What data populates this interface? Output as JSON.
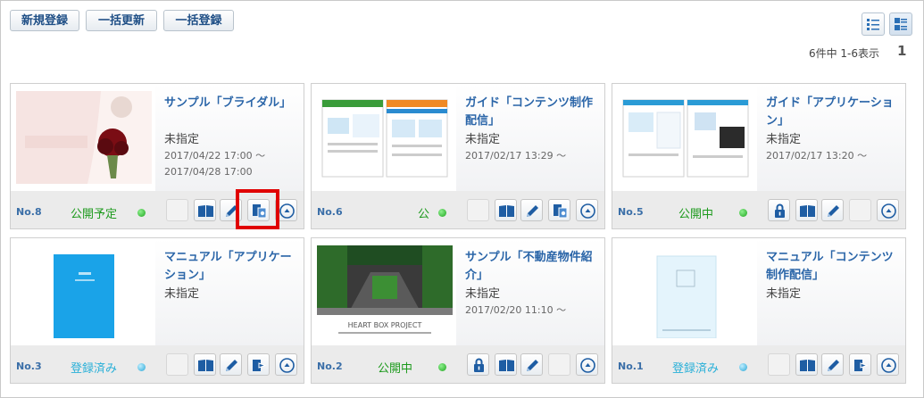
{
  "toolbar": {
    "new_label": "新規登録",
    "bulk_update_label": "一括更新",
    "bulk_register_label": "一括登録"
  },
  "view": {
    "list_icon": "list-view-icon",
    "card_icon": "card-view-icon",
    "active": "card"
  },
  "pagination": {
    "summary": "6件中 1-6表示",
    "page": "1"
  },
  "colors": {
    "published": "#1d9a1d",
    "registered": "#2ab0d8",
    "title": "#2a65a8",
    "highlight": "#e00000"
  },
  "cards": [
    {
      "title": "サンプル「ブライダル」",
      "category": "未指定",
      "date1": "2017/04/22 17:00 ～",
      "date2": "2017/04/28 17:00",
      "no": "No.8",
      "status": "公開予定",
      "status_color": "green"
    },
    {
      "title": "ガイド「コンテンツ制作配信」",
      "category": "未指定",
      "date1": "2017/02/17 13:29 ～",
      "date2": "",
      "no": "No.6",
      "status": "公",
      "status_color": "green"
    },
    {
      "title": "ガイド「アプリケーション」",
      "category": "未指定",
      "date1": "2017/02/17 13:20 ～",
      "date2": "",
      "no": "No.5",
      "status": "公開中",
      "status_color": "green"
    },
    {
      "title": "マニュアル「アプリケーション」",
      "category": "未指定",
      "date1": "",
      "date2": "",
      "no": "No.3",
      "status": "登録済み",
      "status_color": "blue"
    },
    {
      "title": "サンプル「不動産物件紹介」",
      "category": "未指定",
      "date1": "2017/02/20 11:10 ～",
      "date2": "",
      "no": "No.2",
      "status": "公開中",
      "status_color": "green"
    },
    {
      "title": "マニュアル「コンテンツ制作配信」",
      "category": "未指定",
      "date1": "",
      "date2": "",
      "no": "No.1",
      "status": "登録済み",
      "status_color": "blue"
    }
  ],
  "thumb_texts": {
    "realestate_brand": "HEART BOX PROJECT"
  }
}
